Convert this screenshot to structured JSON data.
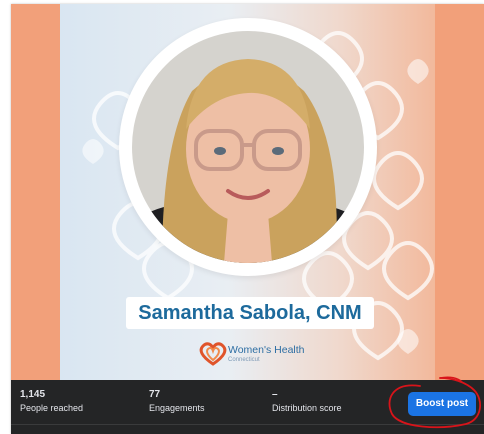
{
  "post": {
    "name_banner": "Samantha Sabola, CNM",
    "logo": {
      "name": "Women's Health",
      "sub": "Connecticut"
    }
  },
  "insights": {
    "people_reached": {
      "value": "1,145",
      "label": "People reached"
    },
    "engagements": {
      "value": "77",
      "label": "Engagements"
    },
    "distribution": {
      "value": "–",
      "label": "Distribution score"
    },
    "boost_label": "Boost post"
  },
  "colors": {
    "brand_blue": "#1d6a9c",
    "boost_blue": "#1b74e4",
    "bar_dark": "#242526",
    "peach": "#f2a07a",
    "annotation_red": "#d8141a"
  }
}
